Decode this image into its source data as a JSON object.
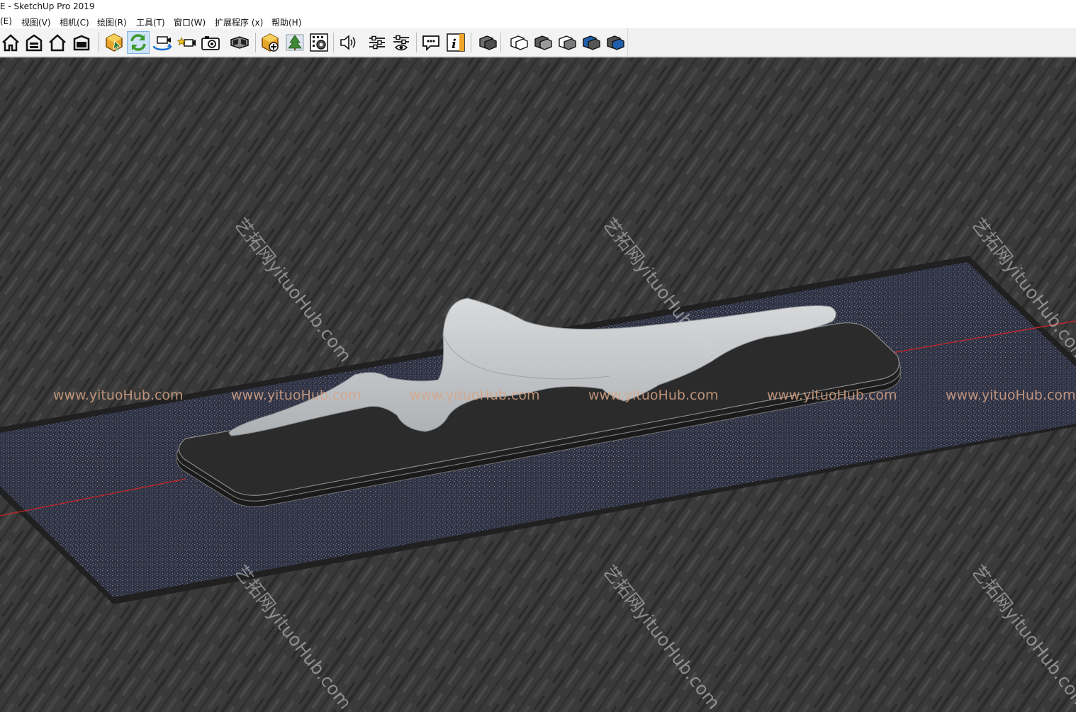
{
  "window": {
    "title": "E - SketchUp Pro 2019"
  },
  "menu": [
    {
      "label": "(E)"
    },
    {
      "label": "视图(V)"
    },
    {
      "label": "相机(C)"
    },
    {
      "label": "绘图(R)"
    },
    {
      "label": "工具(T)"
    },
    {
      "label": "窗口(W)"
    },
    {
      "label": "扩展程序 (x)"
    },
    {
      "label": "帮助(H)"
    }
  ],
  "toolbar": {
    "groups": [
      [
        "home-icon",
        "warehouse-icon",
        "house-outline-icon",
        "component-box-icon"
      ],
      [
        "geolocation-icon",
        "refresh-icon",
        "orbit-camera-icon",
        "camera-star-icon",
        "photo-camera-icon",
        "vr-headset-icon"
      ],
      [
        "add-location-icon",
        "tree-icon",
        "settings-grid-icon"
      ],
      [
        "speaker-icon",
        "sliders-icon",
        "sliders-eye-icon"
      ],
      [
        "message-icon",
        "info-icon"
      ],
      [
        "solid-tools-icon",
        "outer-shell-icon",
        "intersect-icon",
        "union-icon",
        "subtract-icon",
        "trim-icon"
      ]
    ],
    "active": "refresh-icon"
  },
  "viewport": {
    "watermark_text": "www.yituoHub.com",
    "watermark_diagonal": "艺拓网yituoHub.com",
    "colors": {
      "ground": "#3a3a3a",
      "slab": "#2e3140",
      "bench": "#2b2b2b",
      "sculpture": "#c9cccf",
      "axis_red": "#c0272d"
    }
  }
}
